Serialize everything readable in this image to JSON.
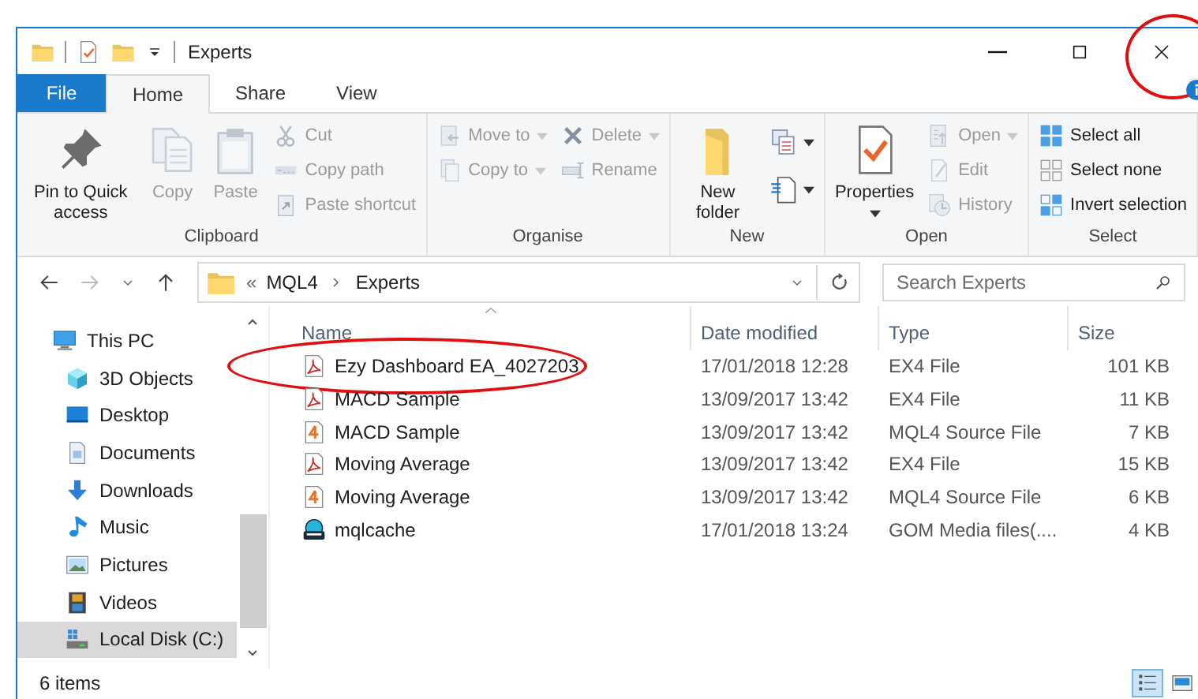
{
  "window": {
    "title": "Experts",
    "close_circled": true
  },
  "tabs": [
    {
      "label": "File",
      "kind": "file",
      "selected": false
    },
    {
      "label": "Home",
      "kind": "tab",
      "selected": true
    },
    {
      "label": "Share",
      "kind": "tab",
      "selected": false
    },
    {
      "label": "View",
      "kind": "tab",
      "selected": false
    }
  ],
  "ribbon": [
    {
      "label": "Clipboard",
      "columns": [
        [
          {
            "label": "Pin to Quick access",
            "kind": "large",
            "disabled": false,
            "dropdown": false
          }
        ],
        [
          {
            "label": "Copy",
            "kind": "large",
            "disabled": true,
            "dropdown": false
          }
        ],
        [
          {
            "label": "Paste",
            "kind": "large",
            "disabled": true,
            "dropdown": false
          }
        ],
        [
          {
            "label": "Cut",
            "kind": "small",
            "disabled": true,
            "dropdown": false
          },
          {
            "label": "Copy path",
            "kind": "small",
            "disabled": true,
            "dropdown": false
          },
          {
            "label": "Paste shortcut",
            "kind": "small",
            "disabled": true,
            "dropdown": false
          }
        ]
      ]
    },
    {
      "label": "Organise",
      "columns": [
        [
          {
            "label": "Move to",
            "kind": "small",
            "disabled": true,
            "dropdown": true
          },
          {
            "label": "Copy to",
            "kind": "small",
            "disabled": true,
            "dropdown": true
          }
        ],
        [
          {
            "label": "Delete",
            "kind": "small",
            "disabled": true,
            "dropdown": true
          },
          {
            "label": "Rename",
            "kind": "small",
            "disabled": true,
            "dropdown": false
          }
        ]
      ]
    },
    {
      "label": "New",
      "columns": [
        [
          {
            "label": "New folder",
            "kind": "large",
            "disabled": false,
            "dropdown": false
          }
        ],
        [
          {
            "kind": "icon",
            "disabled": false,
            "dropdown": true
          },
          {
            "kind": "icon",
            "disabled": false,
            "dropdown": true
          }
        ]
      ]
    },
    {
      "label": "Open",
      "columns": [
        [
          {
            "label": "Properties",
            "kind": "large",
            "disabled": false,
            "dropdown": true
          }
        ],
        [
          {
            "label": "Open",
            "kind": "small",
            "disabled": true,
            "dropdown": true
          },
          {
            "label": "Edit",
            "kind": "small",
            "disabled": true,
            "dropdown": false
          },
          {
            "label": "History",
            "kind": "small",
            "disabled": true,
            "dropdown": false
          }
        ]
      ]
    },
    {
      "label": "Select",
      "columns": [
        [
          {
            "label": "Select all",
            "kind": "small",
            "disabled": false,
            "dropdown": false
          },
          {
            "label": "Select none",
            "kind": "small",
            "disabled": false,
            "dropdown": false
          },
          {
            "label": "Invert selection",
            "kind": "small",
            "disabled": false,
            "dropdown": false
          }
        ]
      ]
    }
  ],
  "address": {
    "overflow": "«",
    "crumbs": [
      "MQL4",
      "Experts"
    ]
  },
  "search": {
    "placeholder": "Search Experts"
  },
  "navigation": [
    {
      "label": "This PC",
      "selected": false,
      "children": [
        {
          "label": "3D Objects",
          "selected": false
        },
        {
          "label": "Desktop",
          "selected": false
        },
        {
          "label": "Documents",
          "selected": false
        },
        {
          "label": "Downloads",
          "selected": false
        },
        {
          "label": "Music",
          "selected": false
        },
        {
          "label": "Pictures",
          "selected": false
        },
        {
          "label": "Videos",
          "selected": false
        },
        {
          "label": "Local Disk (C:)",
          "selected": true
        }
      ]
    }
  ],
  "columns": [
    {
      "label": "Name",
      "sorted": true
    },
    {
      "label": "Date modified",
      "sorted": false
    },
    {
      "label": "Type",
      "sorted": false
    },
    {
      "label": "Size",
      "sorted": false
    }
  ],
  "files": [
    {
      "name": "Ezy Dashboard EA_4027203",
      "date": "17/01/2018 12:28",
      "type": "EX4 File",
      "size": "101 KB",
      "kind": "ex4",
      "circled": true
    },
    {
      "name": "MACD Sample",
      "date": "13/09/2017 13:42",
      "type": "EX4 File",
      "size": "11 KB",
      "kind": "ex4",
      "circled": false
    },
    {
      "name": "MACD Sample",
      "date": "13/09/2017 13:42",
      "type": "MQL4 Source File",
      "size": "7 KB",
      "kind": "mq4",
      "circled": false
    },
    {
      "name": "Moving Average",
      "date": "13/09/2017 13:42",
      "type": "EX4 File",
      "size": "15 KB",
      "kind": "ex4",
      "circled": false
    },
    {
      "name": "Moving Average",
      "date": "13/09/2017 13:42",
      "type": "MQL4 Source File",
      "size": "6 KB",
      "kind": "mq4",
      "circled": false
    },
    {
      "name": "mqlcache",
      "date": "17/01/2018 13:24",
      "type": "GOM Media files(....",
      "size": "4 KB",
      "kind": "dat",
      "circled": false
    }
  ],
  "status": {
    "count": "6 items",
    "views": [
      {
        "kind": "details",
        "selected": true
      },
      {
        "kind": "large",
        "selected": false
      }
    ]
  }
}
